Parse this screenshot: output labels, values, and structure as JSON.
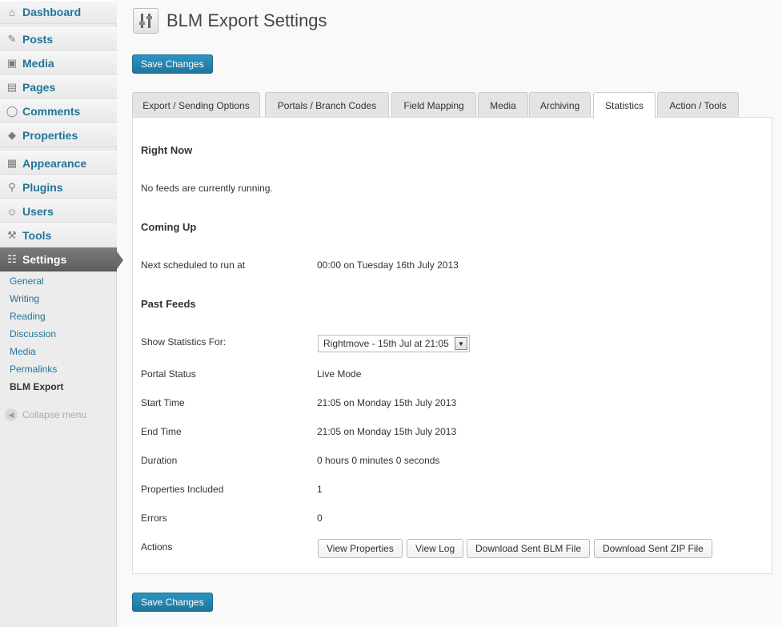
{
  "sidebar": {
    "items": [
      {
        "label": "Dashboard",
        "icon": "dashboard-icon"
      },
      {
        "label": "Posts",
        "icon": "pin-icon"
      },
      {
        "label": "Media",
        "icon": "media-icon"
      },
      {
        "label": "Pages",
        "icon": "pages-icon"
      },
      {
        "label": "Comments",
        "icon": "comment-icon"
      },
      {
        "label": "Properties",
        "icon": "properties-icon"
      },
      {
        "label": "Appearance",
        "icon": "appearance-icon"
      },
      {
        "label": "Plugins",
        "icon": "plugin-icon"
      },
      {
        "label": "Users",
        "icon": "users-icon"
      },
      {
        "label": "Tools",
        "icon": "tools-icon"
      },
      {
        "label": "Settings",
        "icon": "settings-icon"
      }
    ],
    "submenu": [
      "General",
      "Writing",
      "Reading",
      "Discussion",
      "Media",
      "Permalinks",
      "BLM Export"
    ],
    "collapse_label": "Collapse menu"
  },
  "header": {
    "title": "BLM Export Settings",
    "save_label": "Save Changes"
  },
  "tabs": [
    "Export / Sending Options",
    "Portals / Branch Codes",
    "Field Mapping",
    "Media",
    "Archiving",
    "Statistics",
    "Action / Tools"
  ],
  "active_tab": "Statistics",
  "stats": {
    "right_now_heading": "Right Now",
    "right_now_text": "No feeds are currently running.",
    "coming_up_heading": "Coming Up",
    "next_label": "Next scheduled to run at",
    "next_value": "00:00 on Tuesday 16th July 2013",
    "past_heading": "Past Feeds",
    "show_for_label": "Show Statistics For:",
    "show_for_value": "Rightmove - 15th Jul at 21:05",
    "portal_status_label": "Portal Status",
    "portal_status_value": "Live Mode",
    "start_label": "Start Time",
    "start_value": "21:05 on Monday 15th July 2013",
    "end_label": "End Time",
    "end_value": "21:05 on Monday 15th July 2013",
    "duration_label": "Duration",
    "duration_value": "0 hours 0 minutes 0 seconds",
    "props_label": "Properties Included",
    "props_value": "1",
    "errors_label": "Errors",
    "errors_value": "0",
    "actions_label": "Actions",
    "actions": [
      "View Properties",
      "View Log",
      "Download Sent BLM File",
      "Download Sent ZIP File"
    ]
  },
  "colors": {
    "link": "#21759b",
    "primary_button": "#21759b",
    "current_menu": "#6b6b6b"
  }
}
